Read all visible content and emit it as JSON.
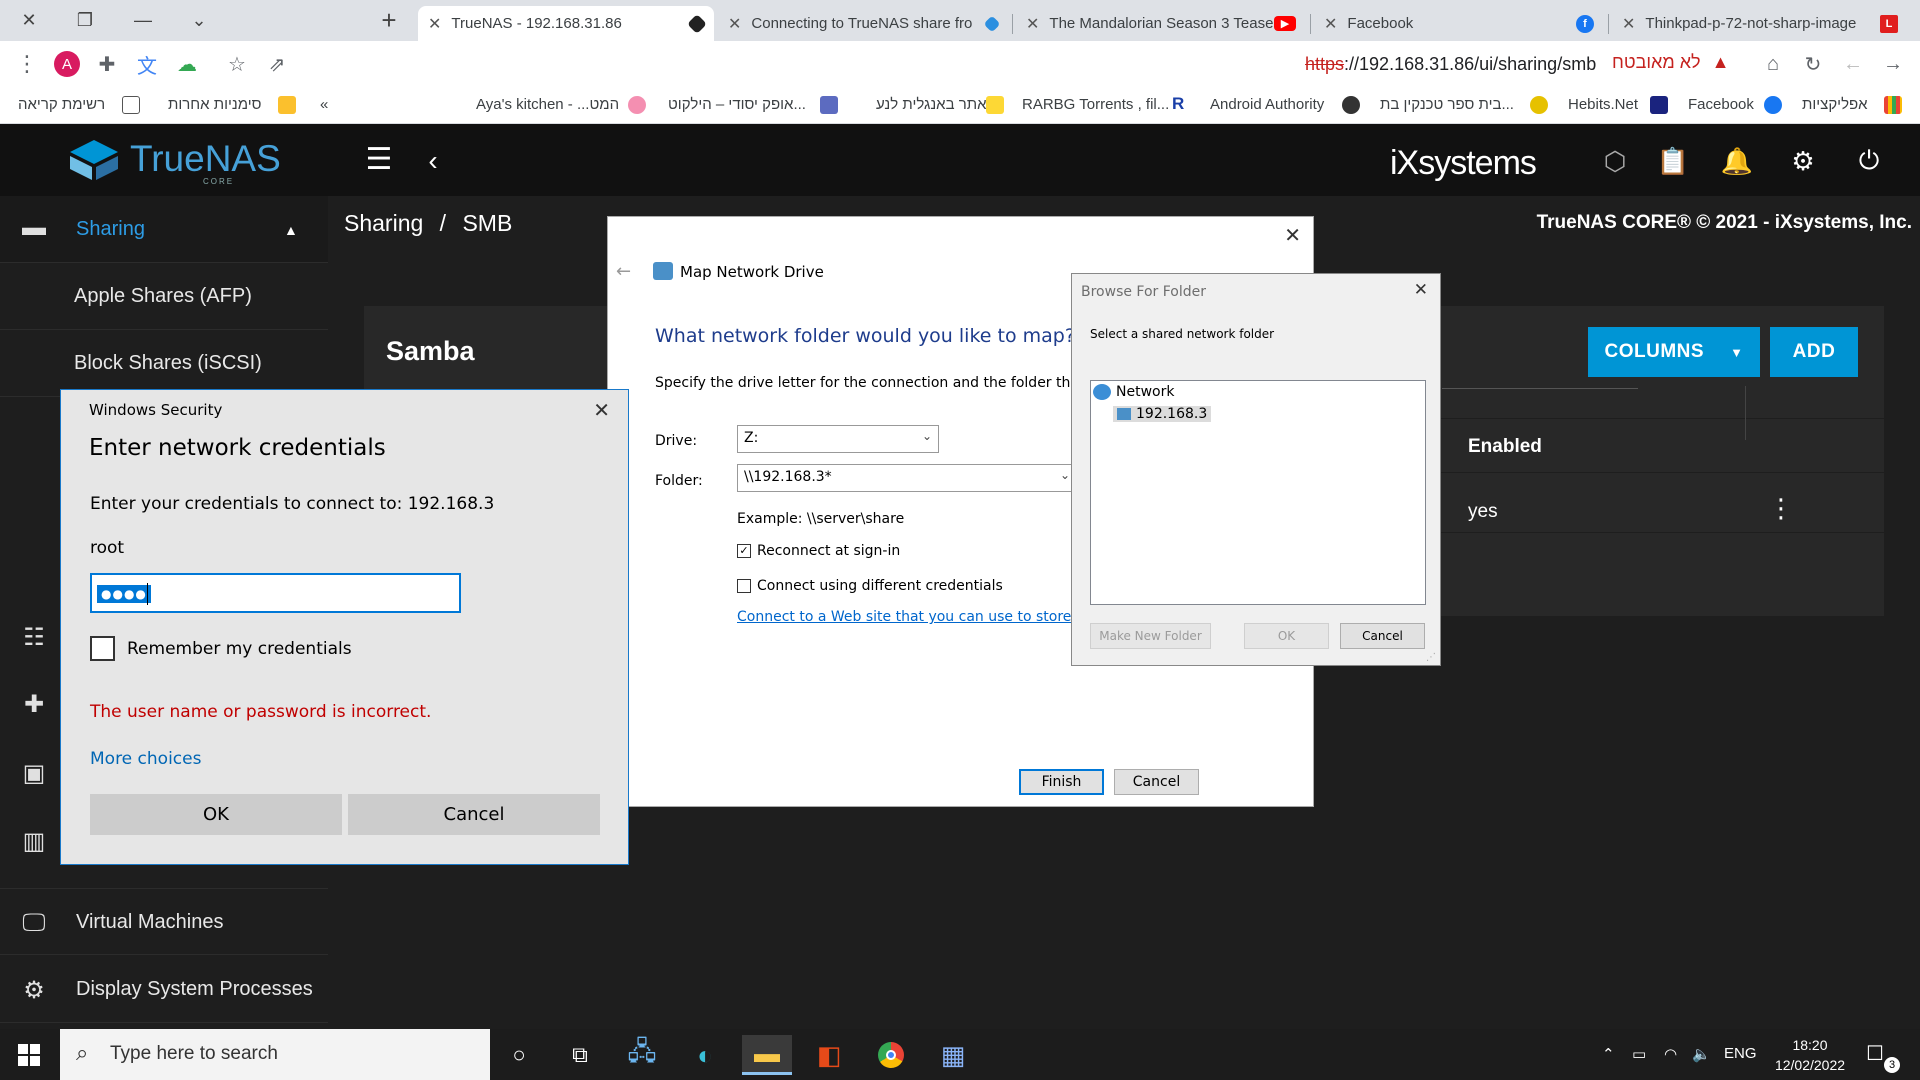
{
  "browser": {
    "tabs": [
      {
        "title": "TrueNAS - 192.168.31.86",
        "active": true
      },
      {
        "title": "Connecting to TrueNAS share fro",
        "active": false
      },
      {
        "title": "The Mandalorian Season 3 Tease",
        "active": false
      },
      {
        "title": "Facebook",
        "active": false
      },
      {
        "title": "Thinkpad-p-72-not-sharp-image",
        "active": false
      }
    ],
    "new_tab": "+",
    "address": {
      "scheme": "https",
      "rest": "://192.168.31.86/ui/sharing/smb",
      "security_label": "לא מאובטח"
    },
    "profile_initial": "A",
    "bookmarks": [
      {
        "label": "אפליקציות"
      },
      {
        "label": "Facebook"
      },
      {
        "label": "Hebits.Net"
      },
      {
        "label": "בית ספר טכנקין בת..."
      },
      {
        "label": "Android Authority"
      },
      {
        "label": "RARBG Torrents , fil..."
      },
      {
        "label": "אתר באנגלית לנע"
      },
      {
        "label": "אופק יסודי – הילקוט..."
      },
      {
        "label": "Aya's kitchen - ...המט"
      },
      {
        "label": "סימניות אחרות"
      },
      {
        "label": "רשימת קריאה"
      }
    ],
    "bookmark_overflow": "«"
  },
  "truenas": {
    "brand": "TrueNAS",
    "brand_sub": "CORE",
    "vendor": "iXsystems",
    "breadcrumb": {
      "section": "Sharing",
      "sep": "/",
      "page": "SMB"
    },
    "copyright": "TrueNAS CORE® © 2021 - iXsystems, Inc.",
    "sidebar": {
      "sharing": "Sharing",
      "afp": "Apple Shares (AFP)",
      "iscsi": "Block Shares (iSCSI)",
      "vms": "Virtual Machines",
      "processes": "Display System Processes"
    },
    "card": {
      "title": "Samba",
      "columns_btn": "COLUMNS",
      "add_btn": "ADD",
      "enabled_header": "Enabled",
      "enabled_value": "yes"
    }
  },
  "map_drive": {
    "title": "Map Network Drive",
    "heading": "What network folder would you like to map?",
    "description": "Specify the drive letter for the connection and the folder that you want to connect to:",
    "drive_label": "Drive:",
    "drive_value": "Z:",
    "folder_label": "Folder:",
    "folder_value": "\\\\192.168.3*",
    "example": "Example: \\\\server\\share",
    "reconnect": "Reconnect at sign-in",
    "reconnect_checked": true,
    "diff_creds": "Connect using different credentials",
    "diff_creds_checked": false,
    "link": "Connect to a Web site that you can use to store your documents and pictures",
    "finish": "Finish",
    "cancel": "Cancel"
  },
  "browse_folder": {
    "title": "Browse For Folder",
    "subtitle": "Select a shared network folder",
    "root": "Network",
    "child": "192.168.3",
    "make_new": "Make New Folder",
    "ok": "OK",
    "cancel": "Cancel"
  },
  "credentials": {
    "app": "Windows Security",
    "heading": "Enter network credentials",
    "prompt": "Enter your credentials to connect to: 192.168.3",
    "username": "root",
    "password_mask": "●●●●",
    "remember": "Remember my credentials",
    "error": "The user name or password is incorrect.",
    "more": "More choices",
    "ok": "OK",
    "cancel": "Cancel"
  },
  "taskbar": {
    "search_placeholder": "Type here to search",
    "lang": "ENG",
    "time": "18:20",
    "date": "12/02/2022",
    "notifications": "3"
  },
  "colors": {
    "truenas_blue": "#0095d5",
    "header_bg": "#111111",
    "error_red": "#c00000",
    "link_blue": "#0066cc"
  }
}
